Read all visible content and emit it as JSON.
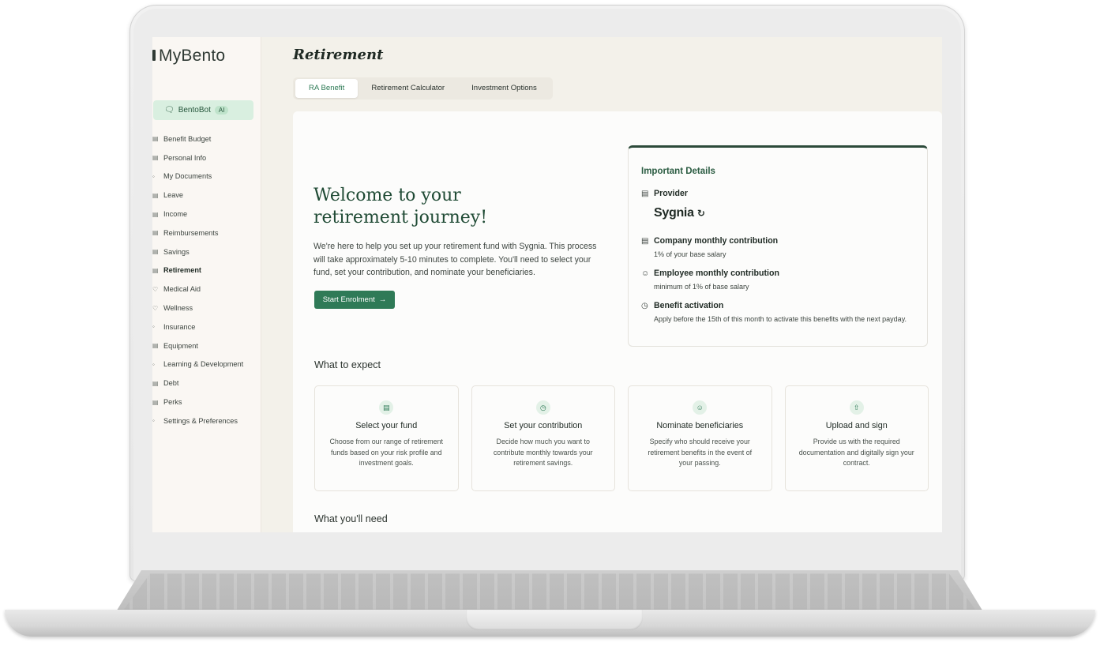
{
  "app": {
    "logo": "MyBento"
  },
  "sidebar": {
    "bentobot": {
      "label": "BentoBot",
      "badge": "AI"
    },
    "items": [
      {
        "label": "Benefit Budget",
        "icon": "wallet-icon"
      },
      {
        "label": "Personal Info",
        "icon": "user-icon"
      },
      {
        "label": "My Documents",
        "icon": "document-icon"
      },
      {
        "label": "Leave",
        "icon": "calendar-icon"
      },
      {
        "label": "Income",
        "icon": "income-icon"
      },
      {
        "label": "Reimbursements",
        "icon": "receipt-icon"
      },
      {
        "label": "Savings",
        "icon": "piggy-bank-icon"
      },
      {
        "label": "Retirement",
        "icon": "building-icon",
        "active": true
      },
      {
        "label": "Medical Aid",
        "icon": "heart-icon"
      },
      {
        "label": "Wellness",
        "icon": "wellness-icon"
      },
      {
        "label": "Insurance",
        "icon": "shield-icon"
      },
      {
        "label": "Equipment",
        "icon": "laptop-icon"
      },
      {
        "label": "Learning & Development",
        "icon": "book-icon"
      },
      {
        "label": "Debt",
        "icon": "debt-icon"
      },
      {
        "label": "Perks",
        "icon": "gift-icon"
      },
      {
        "label": "Settings & Preferences",
        "icon": "gear-icon"
      }
    ]
  },
  "header": {
    "title": "Retirement"
  },
  "tabs": [
    {
      "label": "RA Benefit",
      "active": true
    },
    {
      "label": "Retirement Calculator"
    },
    {
      "label": "Investment Options"
    }
  ],
  "welcome": {
    "heading": "Welcome to your retirement journey!",
    "intro": "We're here to help you set up your retirement fund with Sygnia. This process will take approximately 5-10 minutes to complete. You'll need to select your fund, set your contribution, and nominate your beneficiaries.",
    "start_button": "Start Enrolment"
  },
  "details": {
    "title": "Important Details",
    "provider_label": "Provider",
    "provider_name": "Sygnia",
    "company_label": "Company monthly contribution",
    "company_value": "1% of your base salary",
    "employee_label": "Employee monthly contribution",
    "employee_value": "minimum of 1% of base salary",
    "activation_label": "Benefit activation",
    "activation_value": "Apply before the 15th of this month to activate this benefits with the next payday."
  },
  "expect": {
    "title": "What to expect",
    "cards": [
      {
        "title": "Select your fund",
        "desc": "Choose from our range of retirement funds based on your risk profile and investment goals.",
        "icon": "fund-icon"
      },
      {
        "title": "Set your contribution",
        "desc": "Decide how much you want to contribute monthly towards your retirement savings.",
        "icon": "clock-icon"
      },
      {
        "title": "Nominate beneficiaries",
        "desc": "Specify who should receive your retirement benefits in the event of your passing.",
        "icon": "people-icon"
      },
      {
        "title": "Upload and sign",
        "desc": "Provide us with the required documentation and digitally sign your contract.",
        "icon": "upload-icon"
      }
    ]
  },
  "need": {
    "title": "What you'll need"
  }
}
